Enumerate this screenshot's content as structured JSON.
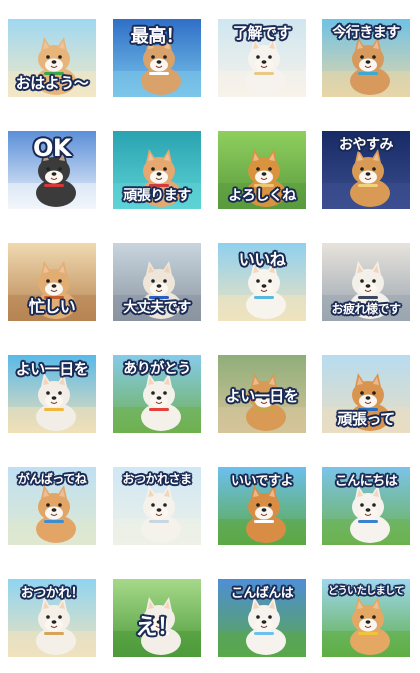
{
  "stickers": [
    {
      "text": "おはよう～",
      "pos": "bot",
      "size": 15,
      "bg": [
        "#9fd8f2",
        "#f3e7c4"
      ],
      "dog": "#e7b47a",
      "accent": "#3aa64a"
    },
    {
      "text": "最高！",
      "pos": "top",
      "size": 18,
      "bg": [
        "#2f6fc7",
        "#7cc6ea"
      ],
      "dog": "#d9a26a",
      "accent": "#ffffff"
    },
    {
      "text": "了解です",
      "pos": "top",
      "size": 15,
      "bg": [
        "#cfe6f0",
        "#f7f2ea"
      ],
      "dog": "#f6f3ee",
      "accent": "#e9c98a"
    },
    {
      "text": "今行きます",
      "pos": "top",
      "size": 14,
      "bg": [
        "#6fc2e4",
        "#e8d6a8"
      ],
      "dog": "#d79a5c",
      "accent": "#3ea9d0"
    },
    {
      "text": "OK",
      "pos": "top",
      "size": 24,
      "bg": [
        "#5b8fd8",
        "#f2f6fb"
      ],
      "dog": "#3b3b3b",
      "accent": "#d8373a"
    },
    {
      "text": "頑張ります",
      "pos": "bot",
      "size": 14,
      "bg": [
        "#2aa3b0",
        "#5fd3d6"
      ],
      "dog": "#e4a870",
      "accent": "#d33a3a"
    },
    {
      "text": "よろしくね",
      "pos": "bot",
      "size": 14,
      "bg": [
        "#8fcf5e",
        "#5a9a3e"
      ],
      "dog": "#d9933f",
      "accent": "#f0c670"
    },
    {
      "text": "おやすみ",
      "pos": "top",
      "size": 14,
      "bg": [
        "#172a66",
        "#3c4f8f"
      ],
      "dog": "#d89a55",
      "accent": "#f3d27a"
    },
    {
      "text": "忙しい",
      "pos": "bot",
      "size": 16,
      "bg": [
        "#f0d9b0",
        "#b78452"
      ],
      "dog": "#e2ad72",
      "accent": "#c25f2b"
    },
    {
      "text": "大丈夫です",
      "pos": "bot",
      "size": 14,
      "bg": [
        "#c8d5de",
        "#8a94a0"
      ],
      "dog": "#efe6da",
      "accent": "#2b5fbf"
    },
    {
      "text": "いいね",
      "pos": "top",
      "size": 16,
      "bg": [
        "#8fd0ee",
        "#f1e3be"
      ],
      "dog": "#f7f4ee",
      "accent": "#58b8e0"
    },
    {
      "text": "お疲れ様です",
      "pos": "bot",
      "size": 12,
      "bg": [
        "#e8e3dc",
        "#9aa5b0"
      ],
      "dog": "#f3f0ea",
      "accent": "#3b4a5a"
    },
    {
      "text": "よい一日を",
      "pos": "top",
      "size": 15,
      "bg": [
        "#59b9e8",
        "#f0e0b8"
      ],
      "dog": "#f2eee7",
      "accent": "#f0b83a"
    },
    {
      "text": "ありがとう",
      "pos": "top",
      "size": 14,
      "bg": [
        "#86cbea",
        "#6fb04f"
      ],
      "dog": "#f4f0ea",
      "accent": "#e3413a"
    },
    {
      "text": "よい一日を",
      "pos": "mid",
      "size": 15,
      "bg": [
        "#8fae7a",
        "#d6c49a"
      ],
      "dog": "#d89a55",
      "accent": "#c9a44a"
    },
    {
      "text": "頑張って",
      "pos": "bot",
      "size": 15,
      "bg": [
        "#b7dcef",
        "#e9ddc2"
      ],
      "dog": "#d9954f",
      "accent": "#2a6fbf"
    },
    {
      "text": "がんばってね",
      "pos": "top",
      "size": 12,
      "bg": [
        "#bfe0f2",
        "#dfe8d0"
      ],
      "dog": "#e2a566",
      "accent": "#3b8fd0"
    },
    {
      "text": "おつかれさま",
      "pos": "top",
      "size": 12,
      "bg": [
        "#cfe7f5",
        "#eef1e6"
      ],
      "dog": "#f5f2ec",
      "accent": "#c8d6e0"
    },
    {
      "text": "いいですよ",
      "pos": "top",
      "size": 13,
      "bg": [
        "#6cc0ee",
        "#5da843"
      ],
      "dog": "#d98c43",
      "accent": "#ffffff"
    },
    {
      "text": "こんにちは",
      "pos": "top",
      "size": 13,
      "bg": [
        "#7cc3ea",
        "#6cb24e"
      ],
      "dog": "#f6f3ee",
      "accent": "#3d7fd0"
    },
    {
      "text": "おつかれ！",
      "pos": "top",
      "size": 13,
      "bg": [
        "#8fd4f0",
        "#f1e2bd"
      ],
      "dog": "#f4f0e8",
      "accent": "#d7a55a"
    },
    {
      "text": "え！",
      "pos": "mid",
      "size": 22,
      "bg": [
        "#a6d98a",
        "#4d9a3a"
      ],
      "dog": "#f3efe8",
      "accent": "#ffffff"
    },
    {
      "text": "こんばんは",
      "pos": "top",
      "size": 13,
      "bg": [
        "#4f8ed6",
        "#5aa84a"
      ],
      "dog": "#f6f3ee",
      "accent": "#6cc0ee"
    },
    {
      "text": "どういたしまして",
      "pos": "top",
      "size": 10,
      "bg": [
        "#9fd7f0",
        "#5fae44"
      ],
      "dog": "#e4a864",
      "accent": "#f2c23a"
    }
  ]
}
